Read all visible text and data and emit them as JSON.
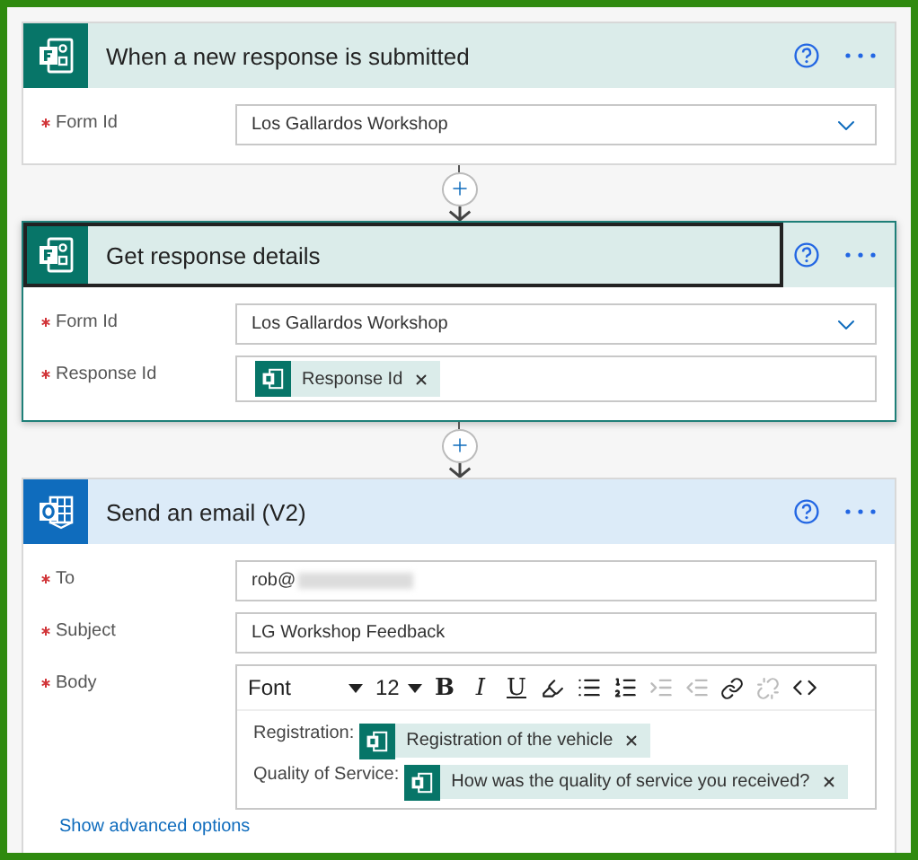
{
  "steps": [
    {
      "kind": "forms",
      "title": "When a new response is submitted",
      "selected": false,
      "fields": [
        {
          "kind": "dropdown",
          "label": "Form Id",
          "required": true,
          "value": "Los Gallardos Workshop"
        }
      ]
    },
    {
      "kind": "forms",
      "title": "Get response details",
      "selected": true,
      "fields": [
        {
          "kind": "dropdown",
          "label": "Form Id",
          "required": true,
          "value": "Los Gallardos Workshop"
        },
        {
          "kind": "tokens",
          "label": "Response Id",
          "required": true,
          "tokens": [
            "Response Id"
          ]
        }
      ]
    },
    {
      "kind": "outlook",
      "title": "Send an email (V2)",
      "selected": false,
      "fields": [
        {
          "kind": "text",
          "label": "To",
          "required": true,
          "value": "rob@",
          "redacted": true
        },
        {
          "kind": "text",
          "label": "Subject",
          "required": true,
          "value": "LG Workshop Feedback"
        },
        {
          "kind": "rich",
          "label": "Body",
          "required": true,
          "toolbar": {
            "font": "Font",
            "size": "12",
            "format_buttons": [
              "B",
              "I",
              "U"
            ]
          },
          "lines": [
            {
              "label": "Registration:",
              "token": "Registration of the vehicle"
            },
            {
              "label": "Quality of Service:",
              "token": "How was the quality of service you received?"
            }
          ]
        }
      ],
      "advanced_link": "Show advanced options"
    }
  ]
}
